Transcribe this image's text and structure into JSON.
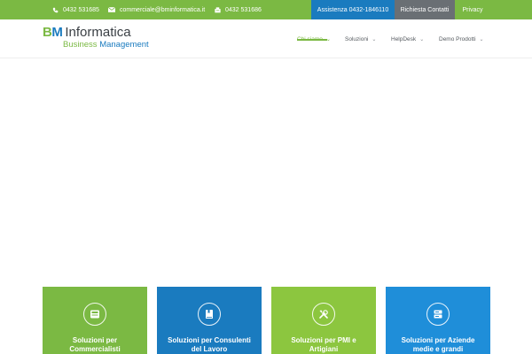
{
  "topbar": {
    "phone": "0432 531685",
    "email": "commerciale@bminformatica.it",
    "fax": "0432 531686",
    "assistenza_label": "Assistenza 0432-1846110",
    "contatti_label": "Richiesta Contatti",
    "privacy_label": "Privacy",
    "icons": [
      "phone-icon",
      "envelope-icon",
      "fax-icon"
    ],
    "colors": {
      "green": "#7bb943",
      "blue": "#1a7bbf",
      "grey": "#6a6f74"
    }
  },
  "logo": {
    "bm_b": "B",
    "bm_m": "M",
    "name": "Informatica",
    "tagline_1": "Business",
    "tagline_2": "Management"
  },
  "nav": {
    "items": [
      {
        "label": "Chi siamo",
        "active": true
      },
      {
        "label": "Soluzioni",
        "active": false
      },
      {
        "label": "HelpDesk",
        "active": false
      },
      {
        "label": "Demo Prodotti",
        "active": false
      }
    ]
  },
  "cards": [
    {
      "title": "Soluzioni per\nCommercialisti",
      "icon": "calculator-icon",
      "color": "#7bb943"
    },
    {
      "title": "Soluzioni per Consulenti\ndel Lavoro",
      "icon": "book-icon",
      "color": "#1a7bbf"
    },
    {
      "title": "Soluzioni per PMI e\nArtigiani",
      "icon": "tools-icon",
      "color": "#8cc63f"
    },
    {
      "title": "Soluzioni per Aziende\nmedie e grandi",
      "icon": "server-icon",
      "color": "#1f8ed9"
    }
  ]
}
